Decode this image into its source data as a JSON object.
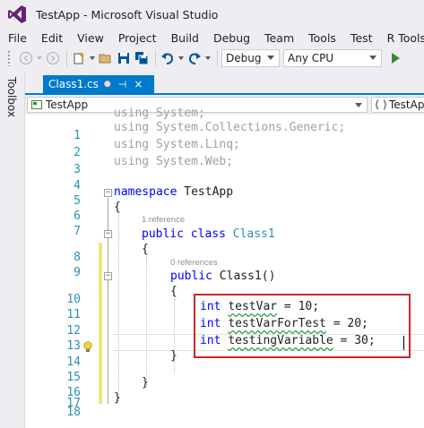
{
  "window": {
    "title": "TestApp - Microsoft Visual Studio"
  },
  "menu": [
    "File",
    "Edit",
    "View",
    "Project",
    "Build",
    "Debug",
    "Team",
    "Tools",
    "Test",
    "R Tools"
  ],
  "toolbar": {
    "config": "Debug",
    "platform": "Any CPU"
  },
  "toolbox": {
    "label": "Toolbox"
  },
  "tab": {
    "name": "Class1.cs",
    "modified_marker": "●",
    "pin": "⊣",
    "close": "×"
  },
  "navbar": {
    "left": "TestApp",
    "right": "TestApp"
  },
  "editor": {
    "line_numbers": [
      "1",
      "2",
      "3",
      "4",
      "5",
      "6",
      "7",
      "8",
      "9",
      "10",
      "11",
      "12",
      "13",
      "14",
      "15",
      "16",
      "17",
      "18"
    ],
    "code": {
      "l1_kw": "using",
      "l1_rest": " System;",
      "l2_kw": "using",
      "l2_rest": " System.Collections.Generic;",
      "l3_kw": "using",
      "l3_rest": " System.Linq;",
      "l4_kw": "using",
      "l4_rest": " System.Web;",
      "l6_kw": "namespace",
      "l6_rest": " TestApp",
      "l7": "{",
      "refs_class": "1 reference",
      "l8_kw": "public class",
      "l8_type": " Class1",
      "l9": "{",
      "refs_ctor": "0 references",
      "l10_kw": "public",
      "l10_rest": " Class1()",
      "l11": "{",
      "l12_kw": "int",
      "l12_var": "testVar",
      "l12_rest": " = 10;",
      "l13_kw": "int",
      "l13_var": "testVarForTest",
      "l13_rest": " = 20;",
      "l14_kw": "int",
      "l14_var": "testingVariable",
      "l14_rest": " = 30;",
      "l15": "}",
      "l17": "}",
      "l18": "}"
    }
  },
  "colors": {
    "accent": "#007acc",
    "keyword": "#0000ff",
    "type": "#2b91af",
    "highlight_box": "#c62828",
    "change_bar": "#efe582"
  }
}
